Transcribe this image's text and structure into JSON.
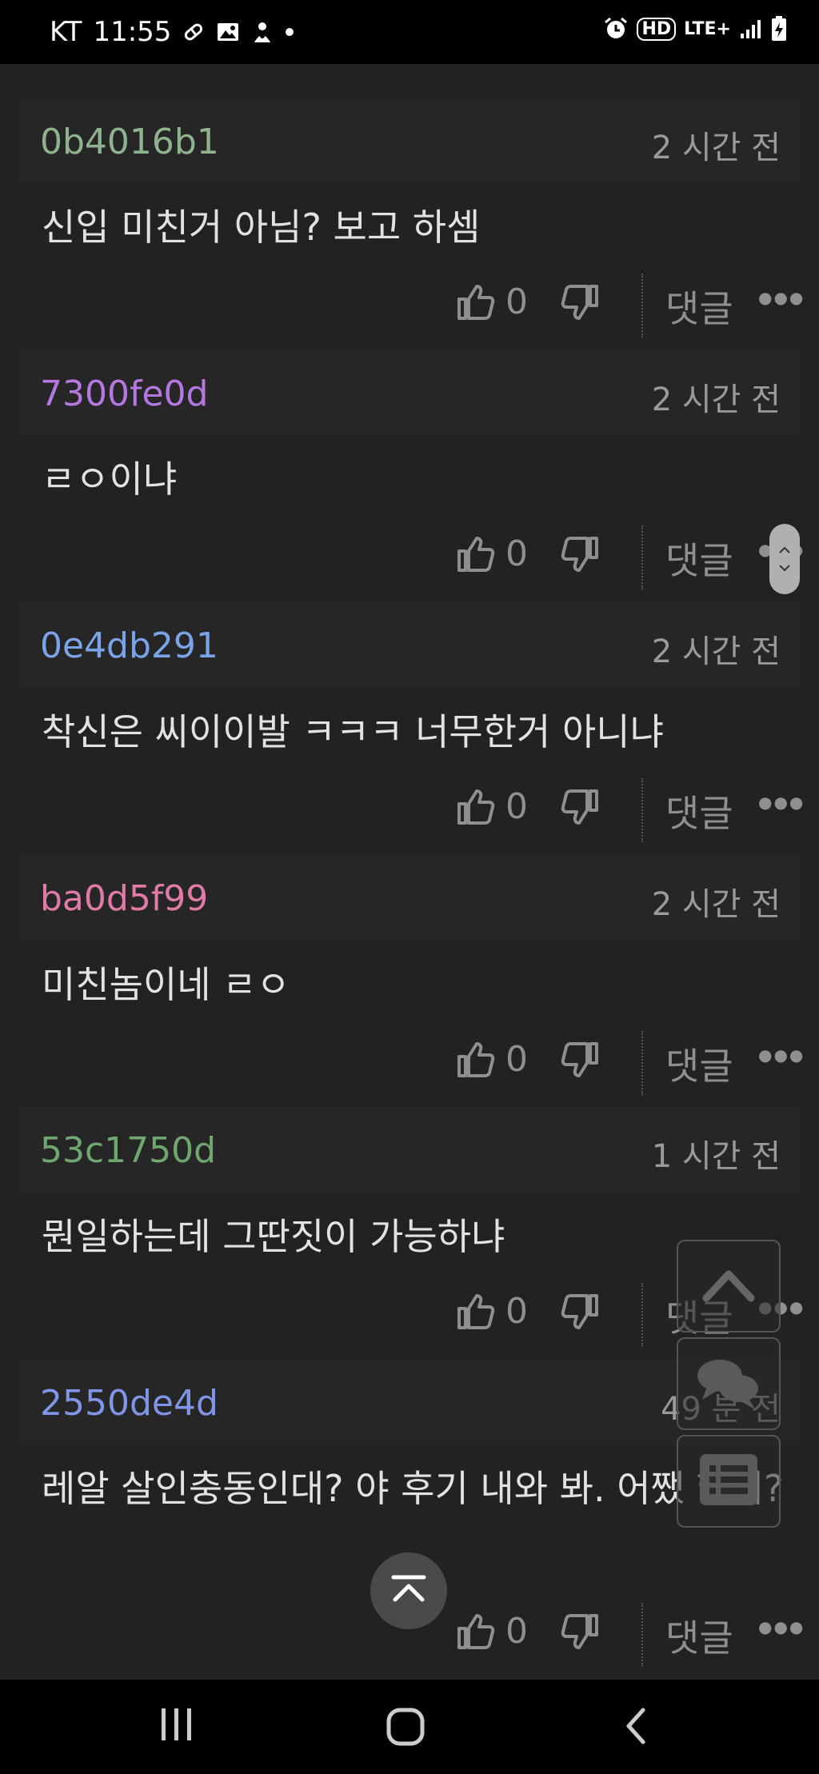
{
  "status_bar": {
    "carrier": "KT",
    "time": "11:55",
    "hd_label": "HD",
    "network_label": "LTE+"
  },
  "comments": [
    {
      "author": "0b4016b1",
      "author_color": "#8fb38f",
      "time": "2 시간 전",
      "body": "신입 미친거 아님? 보고 하셈",
      "likes": "0",
      "reply_label": "댓글"
    },
    {
      "author": "7300fe0d",
      "author_color": "#b478e0",
      "time": "2 시간 전",
      "body": "ㄹㅇ이냐",
      "likes": "0",
      "reply_label": "댓글"
    },
    {
      "author": "0e4db291",
      "author_color": "#7ba4e8",
      "time": "2 시간 전",
      "body": "착신은 씨이이발 ㅋㅋㅋ 너무한거 아니냐",
      "likes": "0",
      "reply_label": "댓글"
    },
    {
      "author": "ba0d5f99",
      "author_color": "#e07aa8",
      "time": "2 시간 전",
      "body": "미친놈이네 ㄹㅇ",
      "likes": "0",
      "reply_label": "댓글"
    },
    {
      "author": "53c1750d",
      "author_color": "#6fa86f",
      "time": "1 시간 전",
      "body": "뭔일하는데 그딴짓이 가능하냐",
      "likes": "0",
      "reply_label": "댓글"
    },
    {
      "author": "2550de4d",
      "author_color": "#7f95e8",
      "time": "49 분 전",
      "body": "레알 살인충동인대? 야 후기 내와 봐. 어쨌 했어?",
      "likes": "0",
      "reply_label": "댓글"
    }
  ]
}
